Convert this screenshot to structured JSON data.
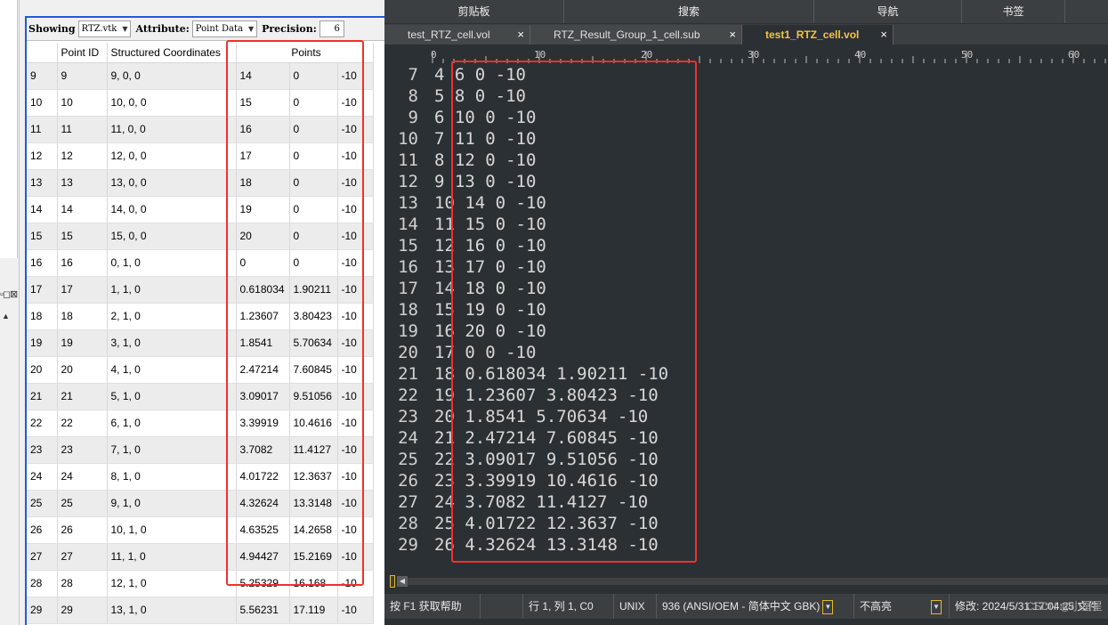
{
  "left_panel": {
    "edge_icons": "▫◻⊠",
    "toolbar": {
      "showing_label": "Showing",
      "showing_value": "RTZ.vtk",
      "attribute_label": "Attribute:",
      "attribute_value": "Point Data",
      "precision_label": "Precision:",
      "precision_value": "6"
    },
    "columns": [
      "",
      "Point ID",
      "Structured Coordinates",
      "Points",
      "",
      ""
    ],
    "rows": [
      [
        "9",
        "9",
        "9, 0, 0",
        "14",
        "0",
        "-10"
      ],
      [
        "10",
        "10",
        "10, 0, 0",
        "15",
        "0",
        "-10"
      ],
      [
        "11",
        "11",
        "11, 0, 0",
        "16",
        "0",
        "-10"
      ],
      [
        "12",
        "12",
        "12, 0, 0",
        "17",
        "0",
        "-10"
      ],
      [
        "13",
        "13",
        "13, 0, 0",
        "18",
        "0",
        "-10"
      ],
      [
        "14",
        "14",
        "14, 0, 0",
        "19",
        "0",
        "-10"
      ],
      [
        "15",
        "15",
        "15, 0, 0",
        "20",
        "0",
        "-10"
      ],
      [
        "16",
        "16",
        "0, 1, 0",
        "0",
        "0",
        "-10"
      ],
      [
        "17",
        "17",
        "1, 1, 0",
        "0.618034",
        "1.90211",
        "-10"
      ],
      [
        "18",
        "18",
        "2, 1, 0",
        "1.23607",
        "3.80423",
        "-10"
      ],
      [
        "19",
        "19",
        "3, 1, 0",
        "1.8541",
        "5.70634",
        "-10"
      ],
      [
        "20",
        "20",
        "4, 1, 0",
        "2.47214",
        "7.60845",
        "-10"
      ],
      [
        "21",
        "21",
        "5, 1, 0",
        "3.09017",
        "9.51056",
        "-10"
      ],
      [
        "22",
        "22",
        "6, 1, 0",
        "3.39919",
        "10.4616",
        "-10"
      ],
      [
        "23",
        "23",
        "7, 1, 0",
        "3.7082",
        "11.4127",
        "-10"
      ],
      [
        "24",
        "24",
        "8, 1, 0",
        "4.01722",
        "12.3637",
        "-10"
      ],
      [
        "25",
        "25",
        "9, 1, 0",
        "4.32624",
        "13.3148",
        "-10"
      ],
      [
        "26",
        "26",
        "10, 1, 0",
        "4.63525",
        "14.2658",
        "-10"
      ],
      [
        "27",
        "27",
        "11, 1, 0",
        "4.94427",
        "15.2169",
        "-10"
      ],
      [
        "28",
        "28",
        "12, 1, 0",
        "5.25329",
        "16.168",
        "-10"
      ],
      [
        "29",
        "29",
        "13, 1, 0",
        "5.56231",
        "17.119",
        "-10"
      ]
    ]
  },
  "editor": {
    "ribbon": [
      "剪贴板",
      "搜索",
      "导航",
      "书签"
    ],
    "tabs": [
      {
        "label": "test_RTZ_cell.vol",
        "active": false
      },
      {
        "label": "RTZ_Result_Group_1_cell.sub",
        "active": false
      },
      {
        "label": "test1_RTZ_cell.vol",
        "active": true
      }
    ],
    "tab_close": "×",
    "ruler_labels": [
      "0",
      "10",
      "20",
      "30",
      "40",
      "50",
      "60"
    ],
    "lines": [
      {
        "n": "7",
        "text": "4 6 0 -10"
      },
      {
        "n": "8",
        "text": "5 8 0 -10"
      },
      {
        "n": "9",
        "text": "6 10 0 -10"
      },
      {
        "n": "10",
        "text": "7 11 0 -10"
      },
      {
        "n": "11",
        "text": "8 12 0 -10"
      },
      {
        "n": "12",
        "text": "9 13 0 -10"
      },
      {
        "n": "13",
        "text": "10 14 0 -10"
      },
      {
        "n": "14",
        "text": "11 15 0 -10"
      },
      {
        "n": "15",
        "text": "12 16 0 -10"
      },
      {
        "n": "16",
        "text": "13 17 0 -10"
      },
      {
        "n": "17",
        "text": "14 18 0 -10"
      },
      {
        "n": "18",
        "text": "15 19 0 -10"
      },
      {
        "n": "19",
        "text": "16 20 0 -10"
      },
      {
        "n": "20",
        "text": "17 0 0 -10"
      },
      {
        "n": "21",
        "text": "18 0.618034 1.90211 -10"
      },
      {
        "n": "22",
        "text": "19 1.23607 3.80423 -10"
      },
      {
        "n": "23",
        "text": "20 1.8541 5.70634 -10"
      },
      {
        "n": "24",
        "text": "21 2.47214 7.60845 -10"
      },
      {
        "n": "25",
        "text": "22 3.09017 9.51056 -10"
      },
      {
        "n": "26",
        "text": "23 3.39919 10.4616 -10"
      },
      {
        "n": "27",
        "text": "24 3.7082 11.4127 -10"
      },
      {
        "n": "28",
        "text": "25 4.01722 12.3637 -10"
      },
      {
        "n": "29",
        "text": "26 4.32624 13.3148 -10"
      }
    ],
    "status": {
      "help": "按 F1 获取帮助",
      "position": "行 1, 列 1, C0",
      "line_ending": "UNIX",
      "codepage": "936  (ANSI/OEM - 简体中文 GBK)",
      "highlight": "不高亮",
      "modified": "修改:   2024/5/31 17:04:25  文件",
      "watermark": "CSDN @小星星"
    }
  },
  "colors": {
    "highlight_box": "#f03030",
    "active_tab_text": "#f5c542",
    "editor_bg": "#2b3035",
    "view_border": "#1e5bd8"
  }
}
